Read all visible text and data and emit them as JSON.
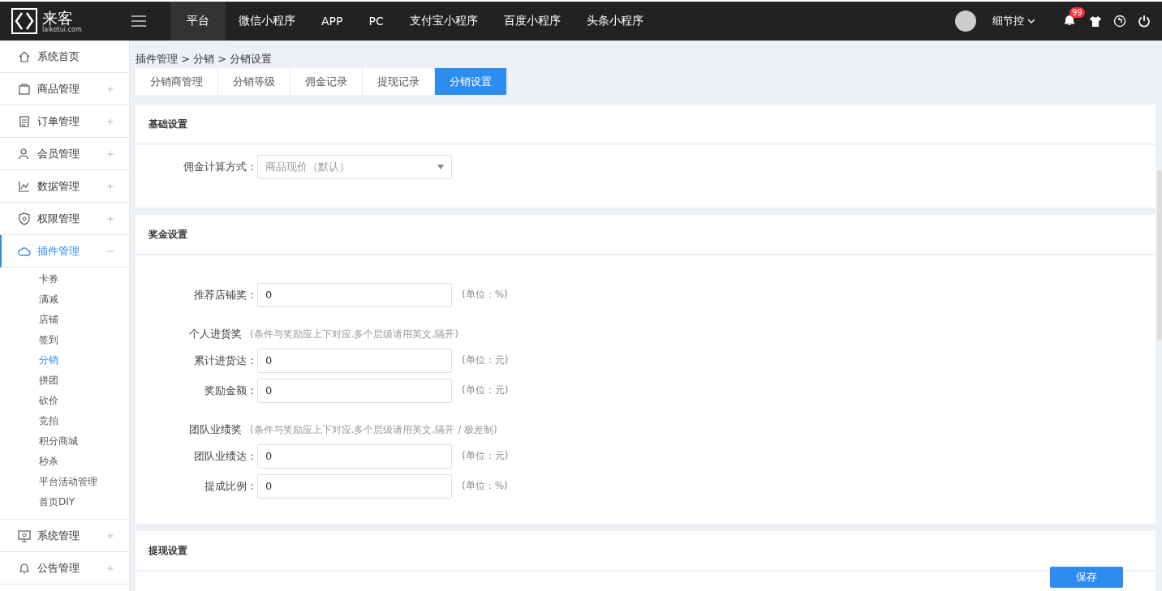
{
  "header": {
    "logo_text": "来客",
    "logo_sub": "laiketui.com",
    "nav": [
      {
        "label": "平台",
        "selected": true
      },
      {
        "label": "微信小程序",
        "selected": false
      },
      {
        "label": "APP",
        "selected": false
      },
      {
        "label": "PC",
        "selected": false
      },
      {
        "label": "支付宝小程序",
        "selected": false
      },
      {
        "label": "百度小程序",
        "selected": false
      },
      {
        "label": "头条小程序",
        "selected": false
      }
    ],
    "user": "细节控",
    "notification_badge": "99"
  },
  "sidebar": {
    "items": [
      {
        "label": "系统首页",
        "selected": false
      },
      {
        "label": "商品管理",
        "expanded": false,
        "selected": false
      },
      {
        "label": "订单管理",
        "expanded": false,
        "selected": false
      },
      {
        "label": "会员管理",
        "expanded": false,
        "selected": false
      },
      {
        "label": "数据管理",
        "expanded": false,
        "selected": false
      },
      {
        "label": "权限管理",
        "expanded": false,
        "selected": false
      },
      {
        "label": "插件管理",
        "expanded": true,
        "selected": true,
        "children": [
          {
            "label": "卡券",
            "selected": false
          },
          {
            "label": "满减",
            "selected": false
          },
          {
            "label": "店铺",
            "selected": false
          },
          {
            "label": "签到",
            "selected": false
          },
          {
            "label": "分销",
            "selected": true
          },
          {
            "label": "拼团",
            "selected": false
          },
          {
            "label": "砍价",
            "selected": false
          },
          {
            "label": "竞拍",
            "selected": false
          },
          {
            "label": "积分商城",
            "selected": false
          },
          {
            "label": "秒杀",
            "selected": false
          },
          {
            "label": "平台活动管理",
            "selected": false
          },
          {
            "label": "首页DIY",
            "selected": false
          }
        ]
      },
      {
        "label": "系统管理",
        "expanded": false,
        "selected": false
      },
      {
        "label": "公告管理",
        "expanded": false,
        "selected": false
      }
    ]
  },
  "breadcrumb": "插件管理 > 分销 > 分销设置",
  "tabs": [
    {
      "label": "分销商管理",
      "selected": false
    },
    {
      "label": "分销等级",
      "selected": false
    },
    {
      "label": "佣金记录",
      "selected": false
    },
    {
      "label": "提现记录",
      "selected": false
    },
    {
      "label": "分销设置",
      "selected": true
    }
  ],
  "sections": [
    {
      "title": "基础设置",
      "rows": [
        {
          "kind": "select",
          "label": "佣金计算方式：",
          "placeholder": "商品现价（默认）"
        }
      ]
    },
    {
      "title": "奖金设置",
      "rows": [
        {
          "kind": "field",
          "label": "推荐店铺奖：",
          "value": "0",
          "unit": "(单位：%)"
        },
        {
          "kind": "group",
          "label": "个人进货奖",
          "hint": "(条件与奖励应上下对应.多个层级请用英文,隔开)"
        },
        {
          "kind": "field",
          "label": "累计进货达：",
          "value": "0",
          "unit": "(单位：元)"
        },
        {
          "kind": "field",
          "label": "奖励金额：",
          "value": "0",
          "unit": "(单位：元)"
        },
        {
          "kind": "group",
          "label": "团队业绩奖",
          "hint": "(条件与奖励应上下对应.多个层级请用英文,隔开 / 极差制)"
        },
        {
          "kind": "field",
          "label": "团队业绩达：",
          "value": "0",
          "unit": "(单位：元)"
        },
        {
          "kind": "field",
          "label": "提成比例：",
          "value": "0",
          "unit": "(单位：%)"
        }
      ]
    },
    {
      "title": "提现设置"
    }
  ],
  "save_button": "保存"
}
